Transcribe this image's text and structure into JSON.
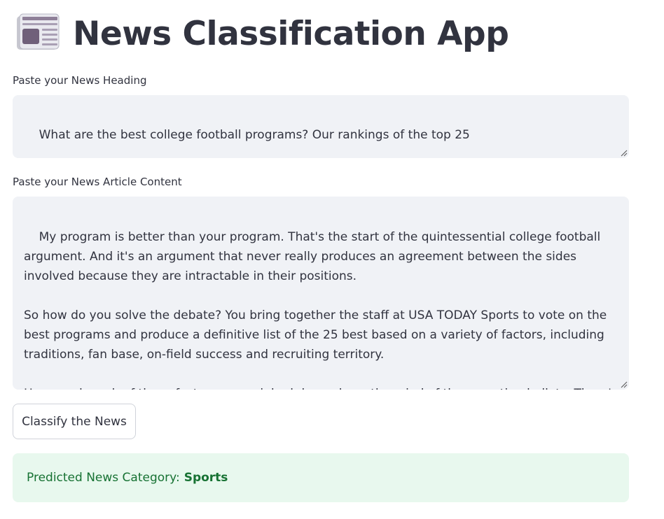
{
  "app": {
    "title": "News Classification App",
    "icon": "newspaper-icon"
  },
  "heading_field": {
    "label": "Paste your News Heading",
    "value": "What are the best college football programs? Our rankings of the top 25"
  },
  "content_field": {
    "label": "Paste your News Article Content",
    "value": "My program is better than your program. That's the start of the quintessential college football argument. And it's an argument that never really produces an agreement between the sides involved because they are intractable in their positions.\n\nSo how do you solve the debate? You bring together the staff at USA TODAY Sports to vote on the best programs and produce a definitive list of the 25 best based on a variety of factors, including traditions, fan base, on-field success and recruiting territory.\n\nHow much each of those factors are weighed depends on the mind of those casting ballots. There's the matter of weighing the historical success of blue-blood programs like Oklahoma, Texas, Notre"
  },
  "classify_button": {
    "label": "Classify the News"
  },
  "result": {
    "prefix": "Predicted News Category:",
    "category": "Sports"
  },
  "colors": {
    "text": "#31333f",
    "field_bg": "#f0f2f6",
    "success_bg": "#e8f8ee",
    "success_text": "#177233"
  }
}
